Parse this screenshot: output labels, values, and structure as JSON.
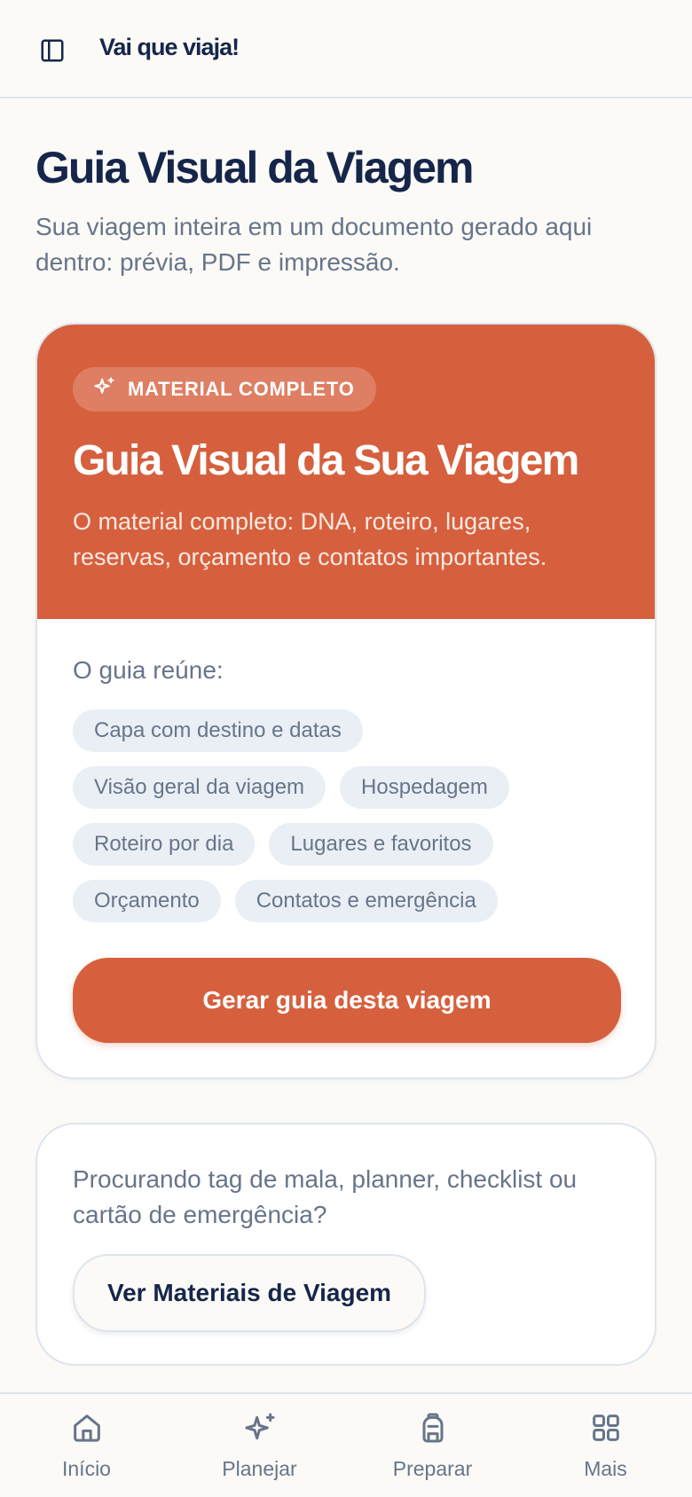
{
  "header": {
    "brand": "Vai que viaja!",
    "sidebar_toggle_icon": "sidebar-panel-icon"
  },
  "page": {
    "title": "Guia Visual da Viagem",
    "subtitle": "Sua viagem inteira em um documento gerado aqui dentro: prévia, PDF e impressão."
  },
  "guide_card": {
    "badge": "MATERIAL COMPLETO",
    "badge_icon": "sparkles-icon",
    "title": "Guia Visual da Sua Viagem",
    "description": "O material completo: DNA, roteiro, lugares, reservas, orçamento e contatos importantes.",
    "includes_label": "O guia reúne:",
    "chips": [
      "Capa com destino e datas",
      "Visão geral da viagem",
      "Hospedagem",
      "Roteiro por dia",
      "Lugares e favoritos",
      "Orçamento",
      "Contatos e emergência"
    ],
    "generate_button": "Gerar guia desta viagem"
  },
  "materials_card": {
    "text": "Procurando tag de mala, planner, checklist ou cartão de emergência?",
    "button": "Ver Materiais de Viagem"
  },
  "bottom_nav": {
    "items": [
      {
        "label": "Início",
        "icon": "home-icon"
      },
      {
        "label": "Planejar",
        "icon": "sparkles-icon"
      },
      {
        "label": "Preparar",
        "icon": "backpack-icon"
      },
      {
        "label": "Mais",
        "icon": "grid-icon"
      }
    ]
  },
  "colors": {
    "accent": "#d6603d",
    "navy": "#16264a",
    "muted_text": "#67758a",
    "chip_bg": "#eaeff5",
    "background": "#fbfaf7",
    "border": "#dde4ec"
  }
}
